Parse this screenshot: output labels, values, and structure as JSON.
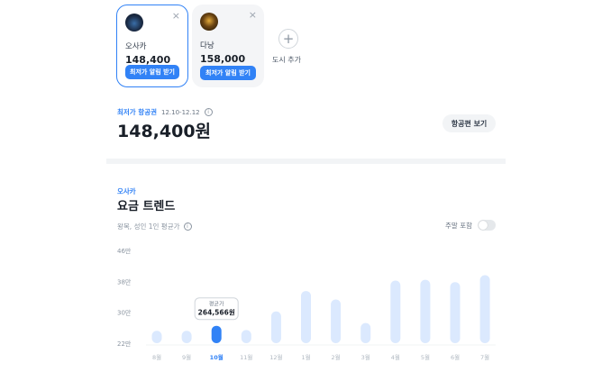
{
  "cards": [
    {
      "city": "오사카",
      "price": "148,400",
      "button": "최저가 알림 받기",
      "close": "×",
      "thumb_icon": "osaka-photo"
    },
    {
      "city": "다낭",
      "price": "158,000",
      "button": "최저가 알림 받기",
      "close": "×",
      "thumb_icon": "danang-photo"
    }
  ],
  "add_city": {
    "icon": "+",
    "label": "도시 추가"
  },
  "fare": {
    "label": "최저가 항공권",
    "dates": "12.10-12.12",
    "info_icon": "i",
    "price": "148,400원",
    "flight_button": "항공편 보기"
  },
  "trend": {
    "city": "오사카",
    "title": "요금 트렌드",
    "subtitle": "왕복, 성인 1인 평균가",
    "info_icon": "i",
    "weekend_label": "주말 포함",
    "weekend_on": false
  },
  "colors": {
    "accent": "#3182f6",
    "bar": "#dbe9fe",
    "bar_selected": "#3182f6"
  },
  "chart_data": {
    "type": "bar",
    "y_tick_labels": [
      "46만",
      "38만",
      "30만",
      "22만"
    ],
    "y_ticks": [
      46,
      38,
      30,
      22
    ],
    "ylim": [
      22,
      46
    ],
    "unit": "만원",
    "categories": [
      "8월",
      "9월",
      "10월",
      "11월",
      "12월",
      "1월",
      "2월",
      "3월",
      "4월",
      "5월",
      "6월",
      "7월"
    ],
    "values": [
      25.2,
      25.2,
      26.5,
      25.4,
      30.2,
      35.5,
      33.3,
      27.2,
      38.2,
      38.4,
      37.8,
      39.6
    ],
    "selected_index": 2,
    "tooltip": {
      "label": "평균가",
      "value": "264,566원"
    }
  }
}
